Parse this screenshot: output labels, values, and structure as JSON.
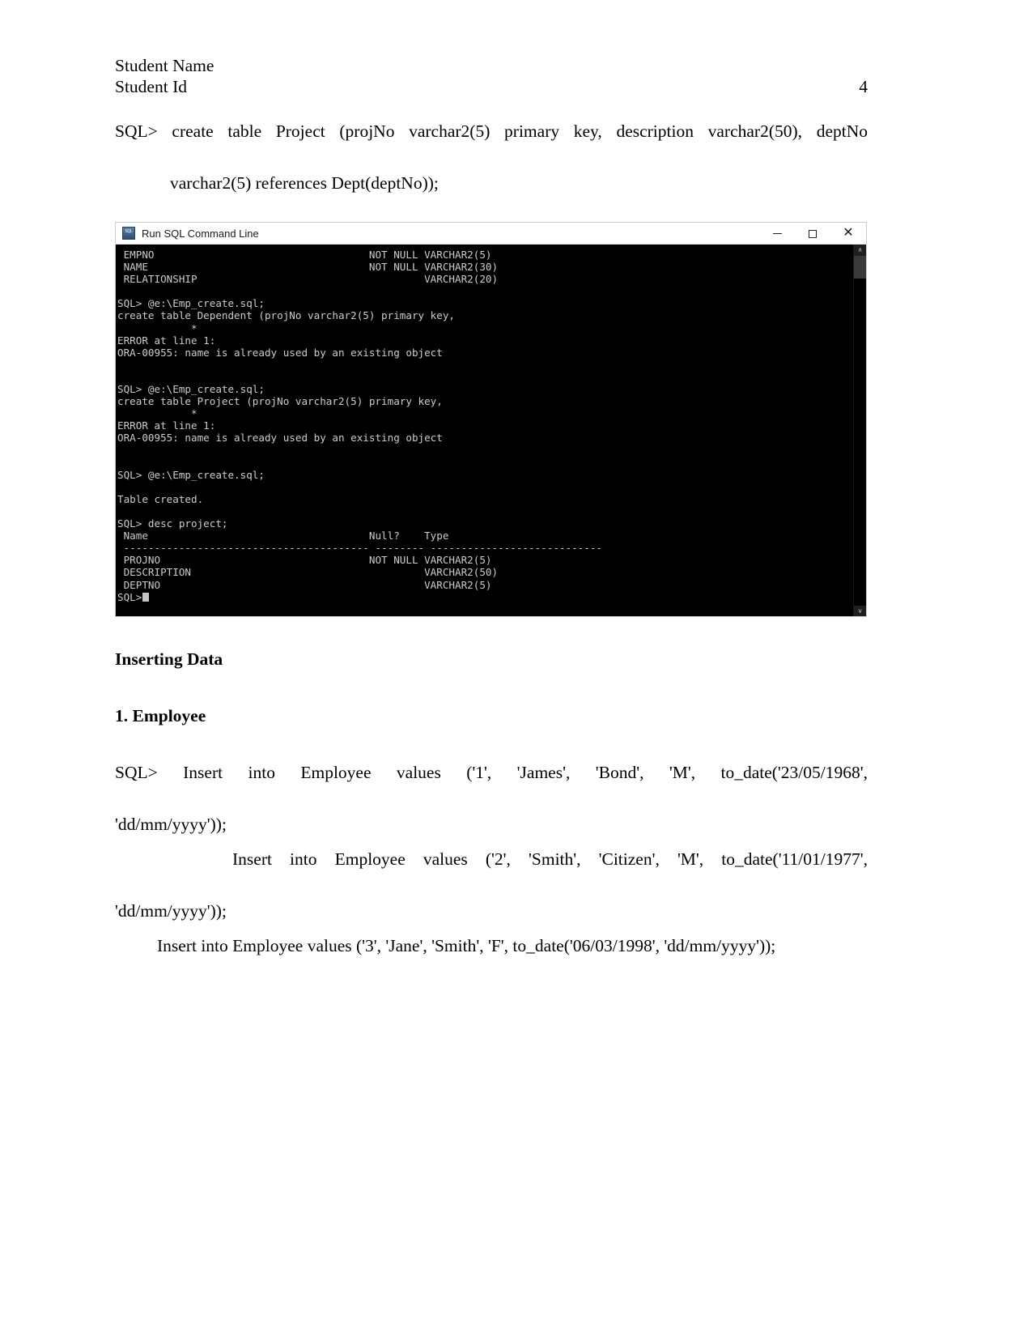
{
  "document": {
    "header": {
      "student_name": "Student Name",
      "student_id": "Student Id",
      "page_number": "4"
    },
    "sql_statement": {
      "line1": "SQL> create table Project (projNo varchar2(5) primary key, description varchar2(50), deptNo",
      "line2": "varchar2(5) references Dept(deptNo));"
    },
    "headings": {
      "inserting_data": "Inserting Data",
      "employee": "1. Employee"
    },
    "inserts": [
      {
        "line1": "SQL> Insert into Employee values ('1', 'James', 'Bond', 'M', to_date('23/05/1968',",
        "line2": "'dd/mm/yyyy'));"
      },
      {
        "line1": "Insert into Employee values ('2', 'Smith', 'Citizen', 'M', to_date('11/01/1977',",
        "line2": "'dd/mm/yyyy'));"
      },
      {
        "line1": "Insert into Employee values ('3', 'Jane', 'Smith', 'F', to_date('06/03/1998', 'dd/mm/yyyy'));"
      }
    ]
  },
  "terminal": {
    "title": "Run SQL Command Line",
    "icon": "sql-app-icon",
    "window_buttons": {
      "minimize": "minimize-button",
      "maximize": "maximize-button",
      "close": "close-button"
    },
    "console_output": " EMPNO                                   NOT NULL VARCHAR2(5)\n NAME                                    NOT NULL VARCHAR2(30)\n RELATIONSHIP                                     VARCHAR2(20)\n\nSQL> @e:\\Emp_create.sql;\ncreate table Dependent (projNo varchar2(5) primary key,\n            *\nERROR at line 1:\nORA-00955: name is already used by an existing object\n\n\nSQL> @e:\\Emp_create.sql;\ncreate table Project (projNo varchar2(5) primary key,\n            *\nERROR at line 1:\nORA-00955: name is already used by an existing object\n\n\nSQL> @e:\\Emp_create.sql;\n\nTable created.\n\nSQL> desc project;\n Name                                    Null?    Type\n ---------------------------------------- -------- ----------------------------\n PROJNO                                  NOT NULL VARCHAR2(5)\n DESCRIPTION                                      VARCHAR2(50)\n DEPTNO                                           VARCHAR2(5)\n",
    "prompt_last": "SQL>",
    "scrollbar": {
      "up_arrow": "∧",
      "down_arrow": "∨"
    }
  }
}
